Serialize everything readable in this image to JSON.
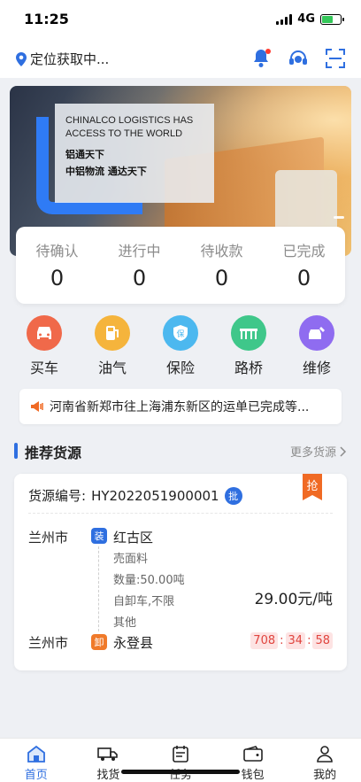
{
  "status_bar": {
    "time": "11:25",
    "network": "4G"
  },
  "header": {
    "location": "定位获取中..."
  },
  "banner": {
    "english": "CHINALCO LOGISTICS HAS ACCESS TO THE WORLD",
    "line_cn1": "铝通天下",
    "line_cn2": "中铝物流 通达天下"
  },
  "stats": [
    {
      "label": "待确认",
      "value": "0"
    },
    {
      "label": "进行中",
      "value": "0"
    },
    {
      "label": "待收款",
      "value": "0"
    },
    {
      "label": "已完成",
      "value": "0"
    }
  ],
  "services": [
    {
      "label": "买车",
      "icon": "car-icon",
      "color": "#f0694a"
    },
    {
      "label": "油气",
      "icon": "fuel-icon",
      "color": "#f5b43c"
    },
    {
      "label": "保险",
      "icon": "insurance-icon",
      "color": "#4cb8ef"
    },
    {
      "label": "路桥",
      "icon": "bridge-icon",
      "color": "#3fc78a"
    },
    {
      "label": "维修",
      "icon": "repair-icon",
      "color": "#8f6cf0"
    }
  ],
  "notice": {
    "text": "河南省新郑市往上海浦东新区的运单已完成等..."
  },
  "section": {
    "title": "推荐货源",
    "more": "更多货源"
  },
  "cargo": {
    "grab_label": "抢",
    "number_label": "货源编号:",
    "number": "HY2022051900001",
    "batch_label": "批",
    "from_city": "兰州市",
    "load_tag": "装",
    "from_district": "红古区",
    "material": "売面料",
    "quantity": "数量:50.00吨",
    "vehicle": "自卸车,不限",
    "other": "其他",
    "price": "29.00元/吨",
    "to_city": "兰州市",
    "unload_tag": "卸",
    "to_district": "永登县",
    "timer": [
      "708",
      "34",
      "58"
    ]
  },
  "tabbar": [
    {
      "label": "首页",
      "icon": "home-icon",
      "active": true
    },
    {
      "label": "找货",
      "icon": "truck-icon",
      "active": false
    },
    {
      "label": "任务",
      "icon": "task-icon",
      "active": false
    },
    {
      "label": "钱包",
      "icon": "wallet-icon",
      "active": false
    },
    {
      "label": "我的",
      "icon": "profile-icon",
      "active": false
    }
  ]
}
